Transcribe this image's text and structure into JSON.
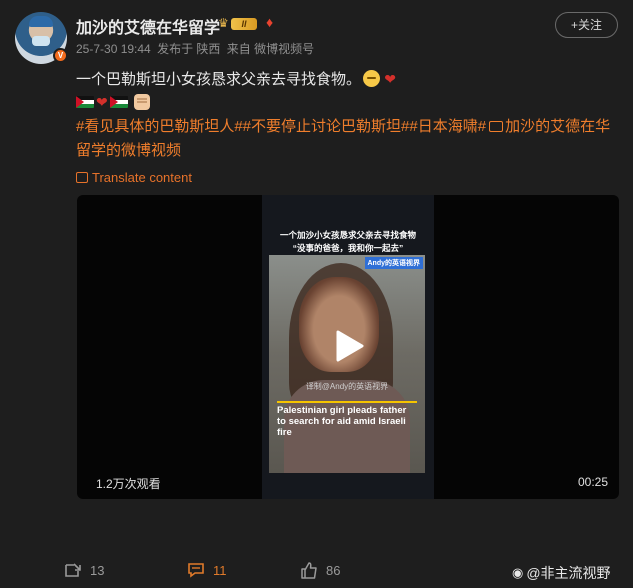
{
  "post": {
    "username": "加沙的艾德在华留学",
    "level_badge": "II",
    "follow_label": "+关注",
    "date": "25-7-30 19:44",
    "posted_from": "发布于 陕西",
    "source": "来自 微博视频号",
    "text_line1": "一个巴勒斯坦小女孩恳求父亲去寻找食物。",
    "hashtags": "#看见具体的巴勒斯坦人##不要停止讨论巴勒斯坦##日本海啸#",
    "video_link_label": "加沙的艾德在华留学的微博视频",
    "translate_label": "Translate content"
  },
  "video": {
    "caption_line1": "一个加沙小女孩恳求父亲去寻找食物",
    "caption_line2": "“没事的爸爸，我和你一起去”",
    "brand_tag": "Andy的英语视界",
    "watermark": "译制@Andy的英语视界",
    "headline": "Palestinian girl pleads father to search for aid amid Israeli fire",
    "views": "1.2万次观看",
    "duration": "00:25"
  },
  "actions": {
    "reposts": "13",
    "comments": "11",
    "likes": "86"
  },
  "watermark_text": "@非主流视野",
  "colors": {
    "accent": "#f07e2c",
    "background": "#1e1e1e"
  }
}
